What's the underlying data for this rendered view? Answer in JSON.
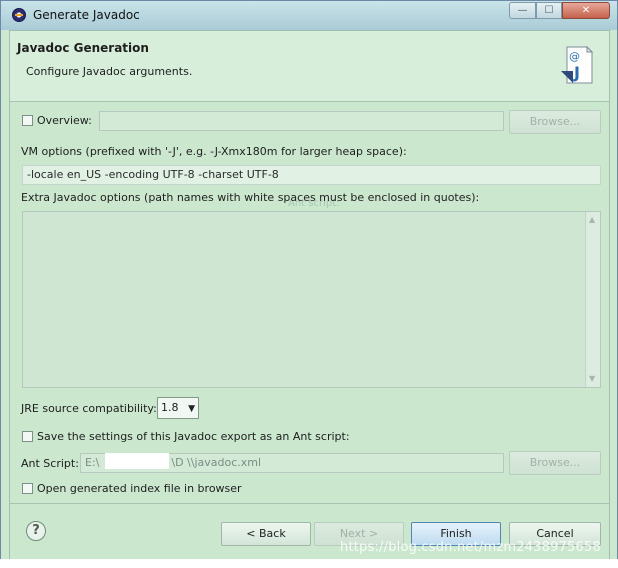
{
  "window": {
    "title": "Generate Javadoc",
    "buttons": {
      "minimize": "—",
      "maximize": "☐",
      "close": "✕"
    }
  },
  "header": {
    "title": "Javadoc Generation",
    "subtitle": "Configure Javadoc arguments.",
    "icon": "javadoc-icon",
    "icon_text": "@J"
  },
  "overview": {
    "label": "Overview:",
    "checked": false,
    "value": "",
    "browse_label": "Browse..."
  },
  "vm_options": {
    "label": "VM options (prefixed with '-J', e.g. -J-Xmx180m for larger heap space):",
    "value": "-locale en_US -encoding UTF-8 -charset UTF-8",
    "ghost_text": "Ant script:"
  },
  "extra_options": {
    "label": "Extra Javadoc options (path names with white spaces must be enclosed in quotes):",
    "value": ""
  },
  "jre": {
    "label": "JRE source compatibility:",
    "selected": "1.8"
  },
  "save_settings": {
    "label": "Save the settings of this Javadoc export as an Ant script:",
    "checked": false
  },
  "ant_script": {
    "label": "Ant Script:",
    "value_prefix": "E:\\",
    "value_middle": "\\D          \\",
    "value_suffix": "\\javadoc.xml",
    "browse_label": "Browse..."
  },
  "open_index": {
    "label": "Open generated index file in browser",
    "checked": false
  },
  "footer": {
    "help_label": "?",
    "back_label": "< Back",
    "next_label": "Next >",
    "finish_label": "Finish",
    "cancel_label": "Cancel"
  },
  "watermark": "https://blog.csdn.net/mzm2438975658",
  "colors": {
    "dialog_bg": "#cbe8cf",
    "accent": "#4f86b3"
  }
}
